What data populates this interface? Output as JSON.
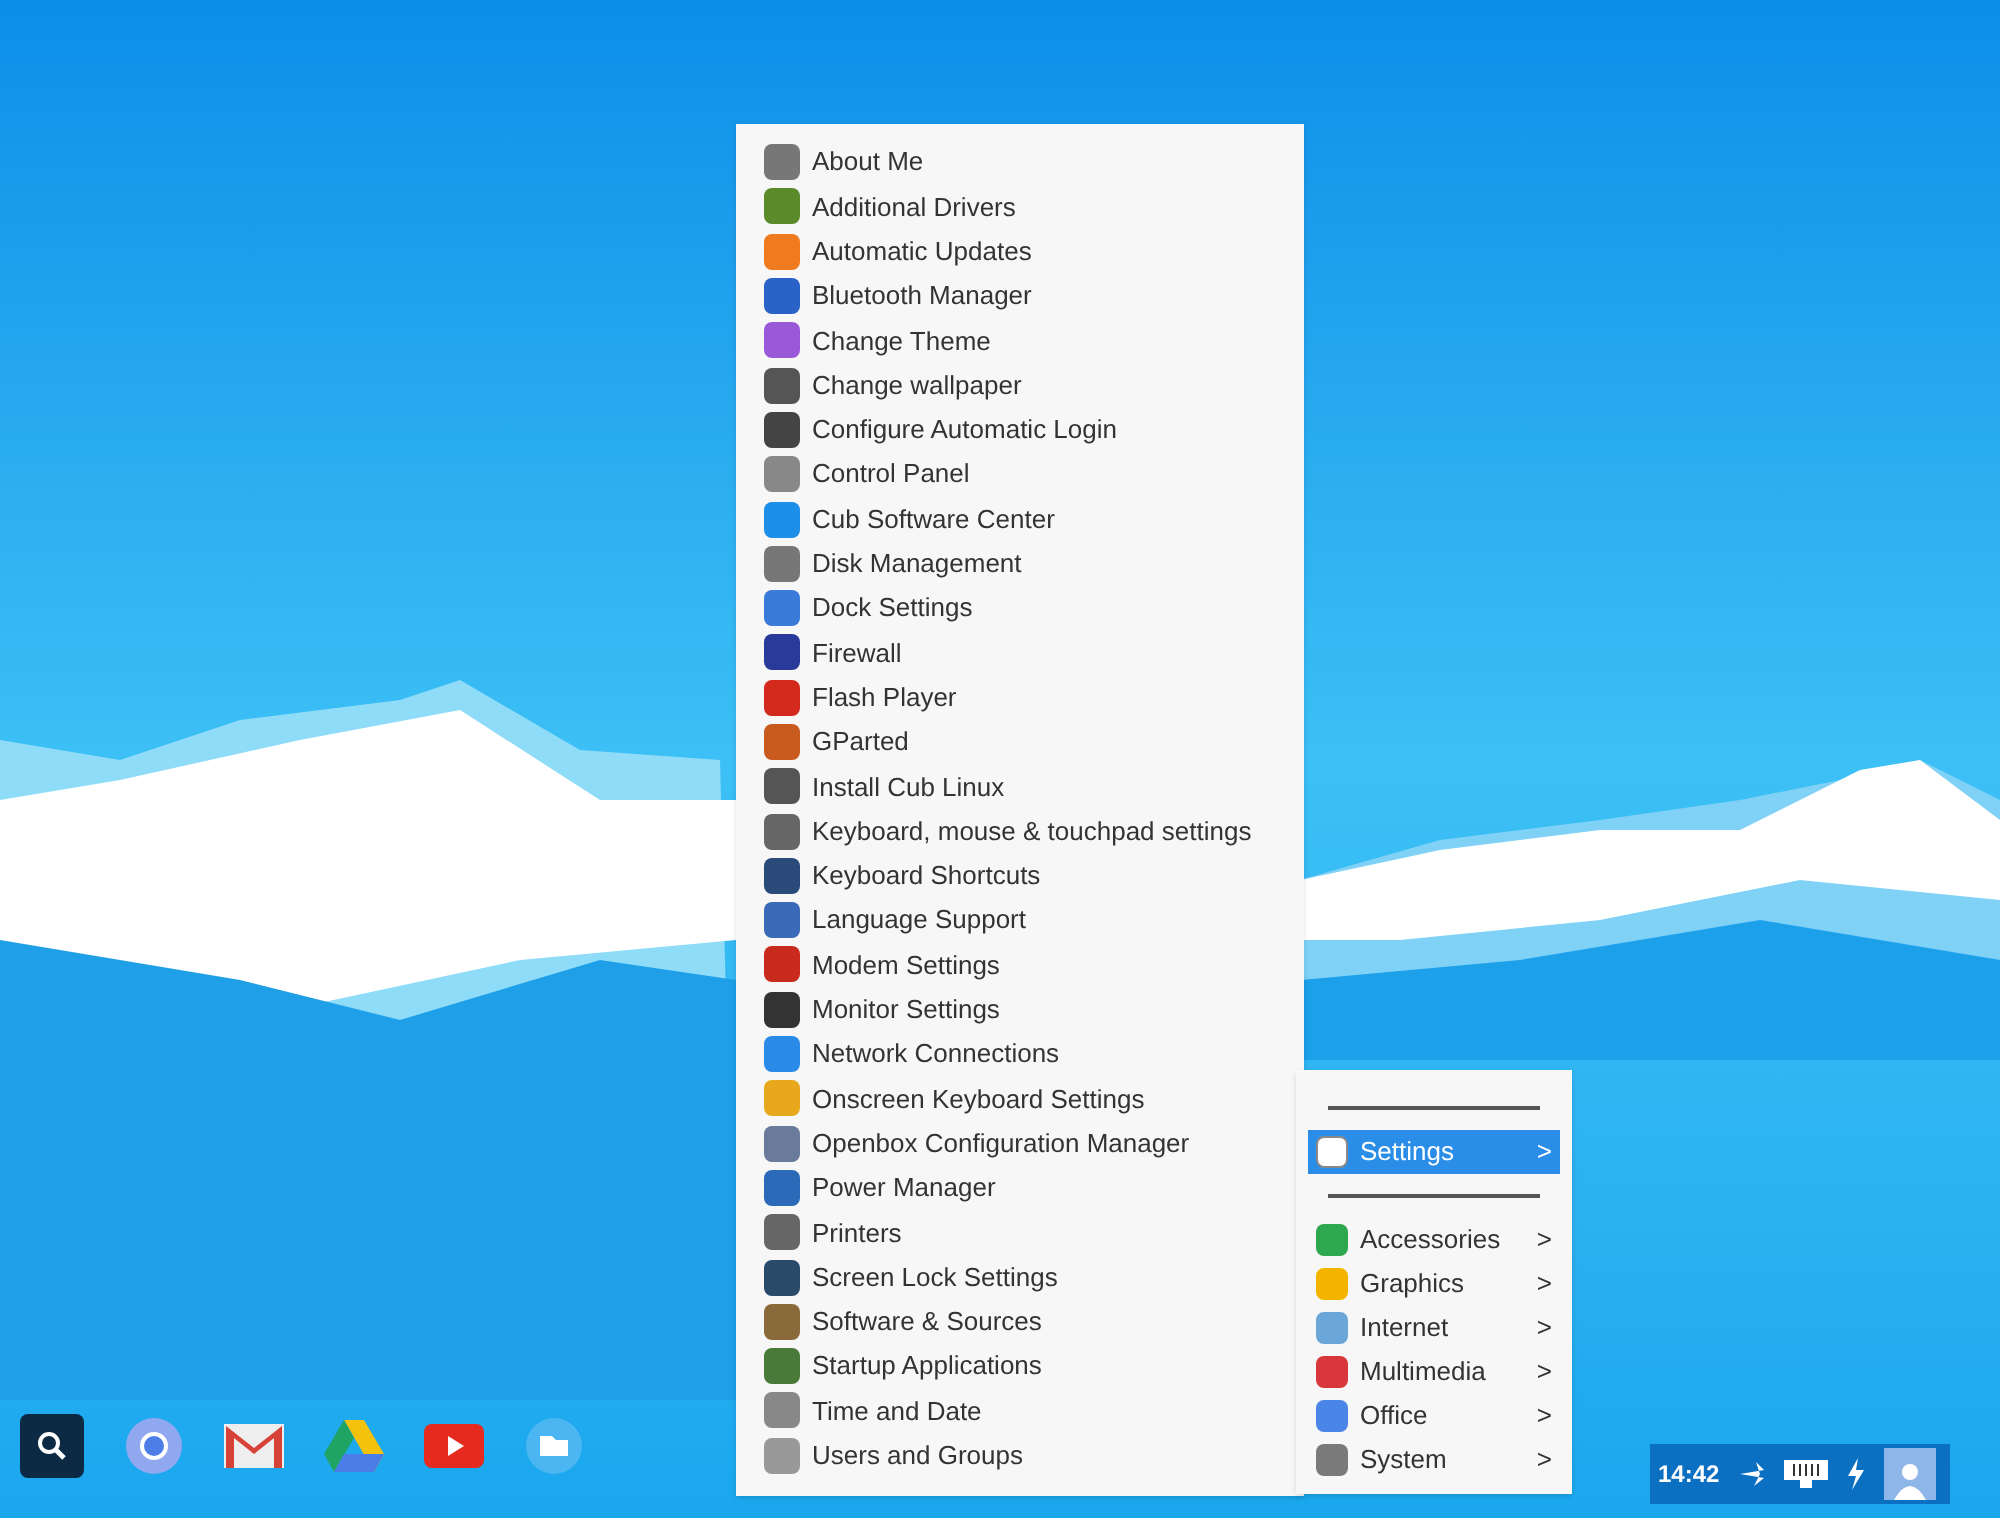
{
  "settings_menu": {
    "items": [
      {
        "label": "About Me"
      },
      {
        "label": "Additional Drivers"
      },
      {
        "label": "Automatic Updates"
      },
      {
        "label": "Bluetooth Manager"
      },
      {
        "label": "Change Theme"
      },
      {
        "label": "Change wallpaper"
      },
      {
        "label": "Configure Automatic Login"
      },
      {
        "label": "Control Panel"
      },
      {
        "label": "Cub Software Center"
      },
      {
        "label": "Disk Management"
      },
      {
        "label": "Dock Settings"
      },
      {
        "label": "Firewall"
      },
      {
        "label": "Flash Player"
      },
      {
        "label": "GParted"
      },
      {
        "label": "Install Cub Linux"
      },
      {
        "label": "Keyboard, mouse & touchpad settings"
      },
      {
        "label": "Keyboard Shortcuts"
      },
      {
        "label": "Language Support"
      },
      {
        "label": "Modem Settings"
      },
      {
        "label": "Monitor Settings"
      },
      {
        "label": "Network Connections"
      },
      {
        "label": "Onscreen Keyboard Settings"
      },
      {
        "label": "Openbox Configuration Manager"
      },
      {
        "label": "Power Manager"
      },
      {
        "label": "Printers"
      },
      {
        "label": "Screen Lock Settings"
      },
      {
        "label": "Software & Sources"
      },
      {
        "label": "Startup Applications"
      },
      {
        "label": "Time and Date"
      },
      {
        "label": "Users and Groups"
      }
    ]
  },
  "app_menu": {
    "top": [
      {
        "label": "Settings",
        "arrow": ">",
        "selected": true
      }
    ],
    "categories": [
      {
        "label": "Accessories",
        "arrow": ">",
        "selected": false,
        "color": "#2ea84f"
      },
      {
        "label": "Graphics",
        "arrow": ">",
        "selected": false,
        "color": "#f4b400"
      },
      {
        "label": "Internet",
        "arrow": ">",
        "selected": false,
        "color": "#6aa6d8"
      },
      {
        "label": "Multimedia",
        "arrow": ">",
        "selected": false,
        "color": "#d9363e"
      },
      {
        "label": "Office",
        "arrow": ">",
        "selected": false,
        "color": "#4a86e8"
      },
      {
        "label": "System",
        "arrow": ">",
        "selected": false,
        "color": "#7a7a7a"
      }
    ]
  },
  "tray": {
    "clock": "14:42"
  }
}
